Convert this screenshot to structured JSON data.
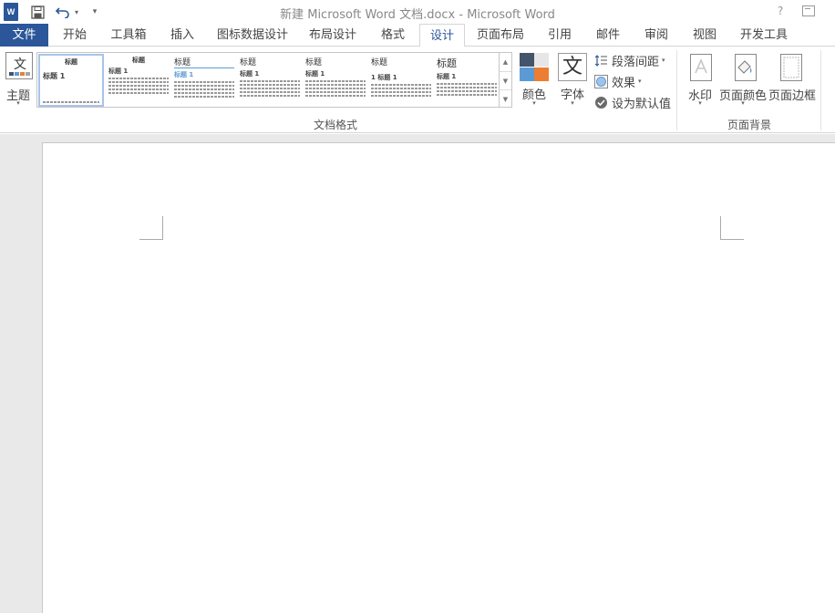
{
  "window": {
    "title": "新建 Microsoft Word 文档.docx - Microsoft Word",
    "help": "?",
    "logo_text": "W"
  },
  "tabs": [
    {
      "label": "文件"
    },
    {
      "label": "开始"
    },
    {
      "label": "工具箱"
    },
    {
      "label": "插入"
    },
    {
      "label": "图标数据设计"
    },
    {
      "label": "布局设计"
    },
    {
      "label": "格式"
    },
    {
      "label": "设计"
    },
    {
      "label": "页面布局"
    },
    {
      "label": "引用"
    },
    {
      "label": "邮件"
    },
    {
      "label": "审阅"
    },
    {
      "label": "视图"
    },
    {
      "label": "开发工具"
    }
  ],
  "active_tab": "设计",
  "ribbon": {
    "theme_label": "主题",
    "theme_icon_text": "文",
    "doc_format_group": "文档格式",
    "page_background_group": "页面背景",
    "gallery": [
      {
        "heading": "标题",
        "sub": "标题 1"
      },
      {
        "heading": "标题",
        "sub": "标题 1"
      },
      {
        "heading": "标题",
        "sub": "标题 1"
      },
      {
        "heading": "标题",
        "sub": "标题 1"
      },
      {
        "heading": "标题",
        "sub": "标题 1"
      },
      {
        "heading": "标题",
        "sub": "1 标题 1"
      },
      {
        "heading": "标题",
        "sub": "标题 1"
      }
    ],
    "colors_label": "颜色",
    "fonts_label": "字体",
    "fonts_icon_text": "文",
    "paragraph_spacing": "段落间距",
    "effects": "效果",
    "set_default": "设为默认值",
    "watermark": "水印",
    "page_color": "页面颜色",
    "page_borders": "页面边框"
  },
  "colors": {
    "accent": "#2b579a",
    "swatch_tl": "#44546a",
    "swatch_tr": "#e7e6e6",
    "swatch_bl": "#5b9bd5",
    "swatch_br": "#ed7d31"
  }
}
